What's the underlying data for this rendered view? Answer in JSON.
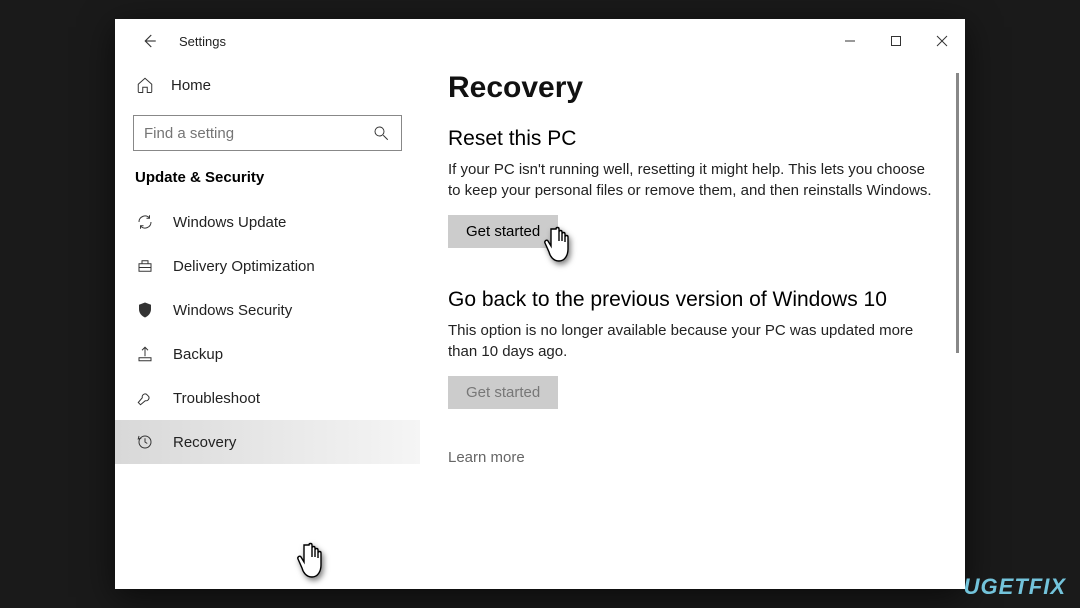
{
  "window": {
    "title": "Settings"
  },
  "sidebar": {
    "home_label": "Home",
    "search_placeholder": "Find a setting",
    "category_label": "Update & Security",
    "items": [
      {
        "label": "Windows Update"
      },
      {
        "label": "Delivery Optimization"
      },
      {
        "label": "Windows Security"
      },
      {
        "label": "Backup"
      },
      {
        "label": "Troubleshoot"
      },
      {
        "label": "Recovery"
      }
    ]
  },
  "content": {
    "page_title": "Recovery",
    "sections": [
      {
        "title": "Reset this PC",
        "desc": "If your PC isn't running well, resetting it might help. This lets you choose to keep your personal files or remove them, and then reinstalls Windows.",
        "button": "Get started"
      },
      {
        "title": "Go back to the previous version of Windows 10",
        "desc": "This option is no longer available because your PC was updated more than 10 days ago.",
        "button": "Get started"
      }
    ],
    "learn_more": "Learn more"
  },
  "watermark": "UGETFIX"
}
